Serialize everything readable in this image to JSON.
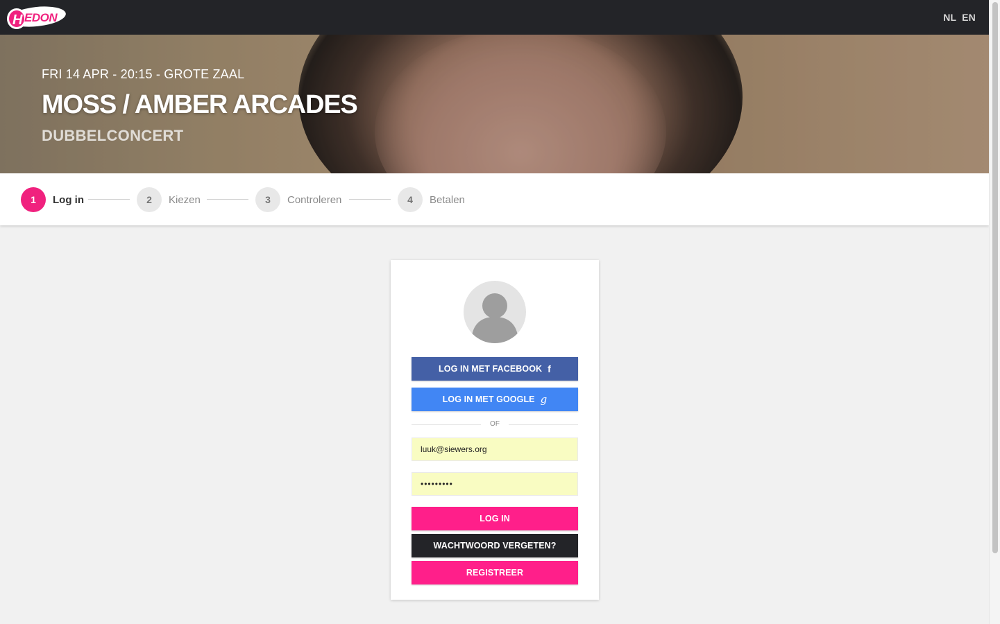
{
  "brand": {
    "logo_text": "HEDON",
    "logo_color": "#f0217e"
  },
  "language": {
    "options": [
      "NL",
      "EN"
    ]
  },
  "event": {
    "meta": "FRI 14 APR - 20:15 - GROTE ZAAL",
    "title": "MOSS / AMBER ARCADES",
    "subtitle": "DUBBELCONCERT"
  },
  "steps": [
    {
      "number": "1",
      "label": "Log in",
      "active": true
    },
    {
      "number": "2",
      "label": "Kiezen",
      "active": false
    },
    {
      "number": "3",
      "label": "Controleren",
      "active": false
    },
    {
      "number": "4",
      "label": "Betalen",
      "active": false
    }
  ],
  "login": {
    "avatar_icon": "user-silhouette-icon",
    "facebook_label": "LOG IN MET FACEBOOK",
    "facebook_icon": "facebook-icon",
    "google_label": "LOG IN MET GOOGLE",
    "google_icon": "google-icon",
    "divider_text": "OF",
    "email_value": "luuk@siewers.org",
    "password_value": "•••••••••",
    "login_label": "LOG IN",
    "forgot_label": "WACHTWOORD VERGETEN?",
    "register_label": "REGISTREER"
  },
  "colors": {
    "accent": "#f0217e",
    "dark": "#232428",
    "facebook": "#4460a6",
    "google": "#4186f4",
    "autofill": "#f9fcc2"
  }
}
